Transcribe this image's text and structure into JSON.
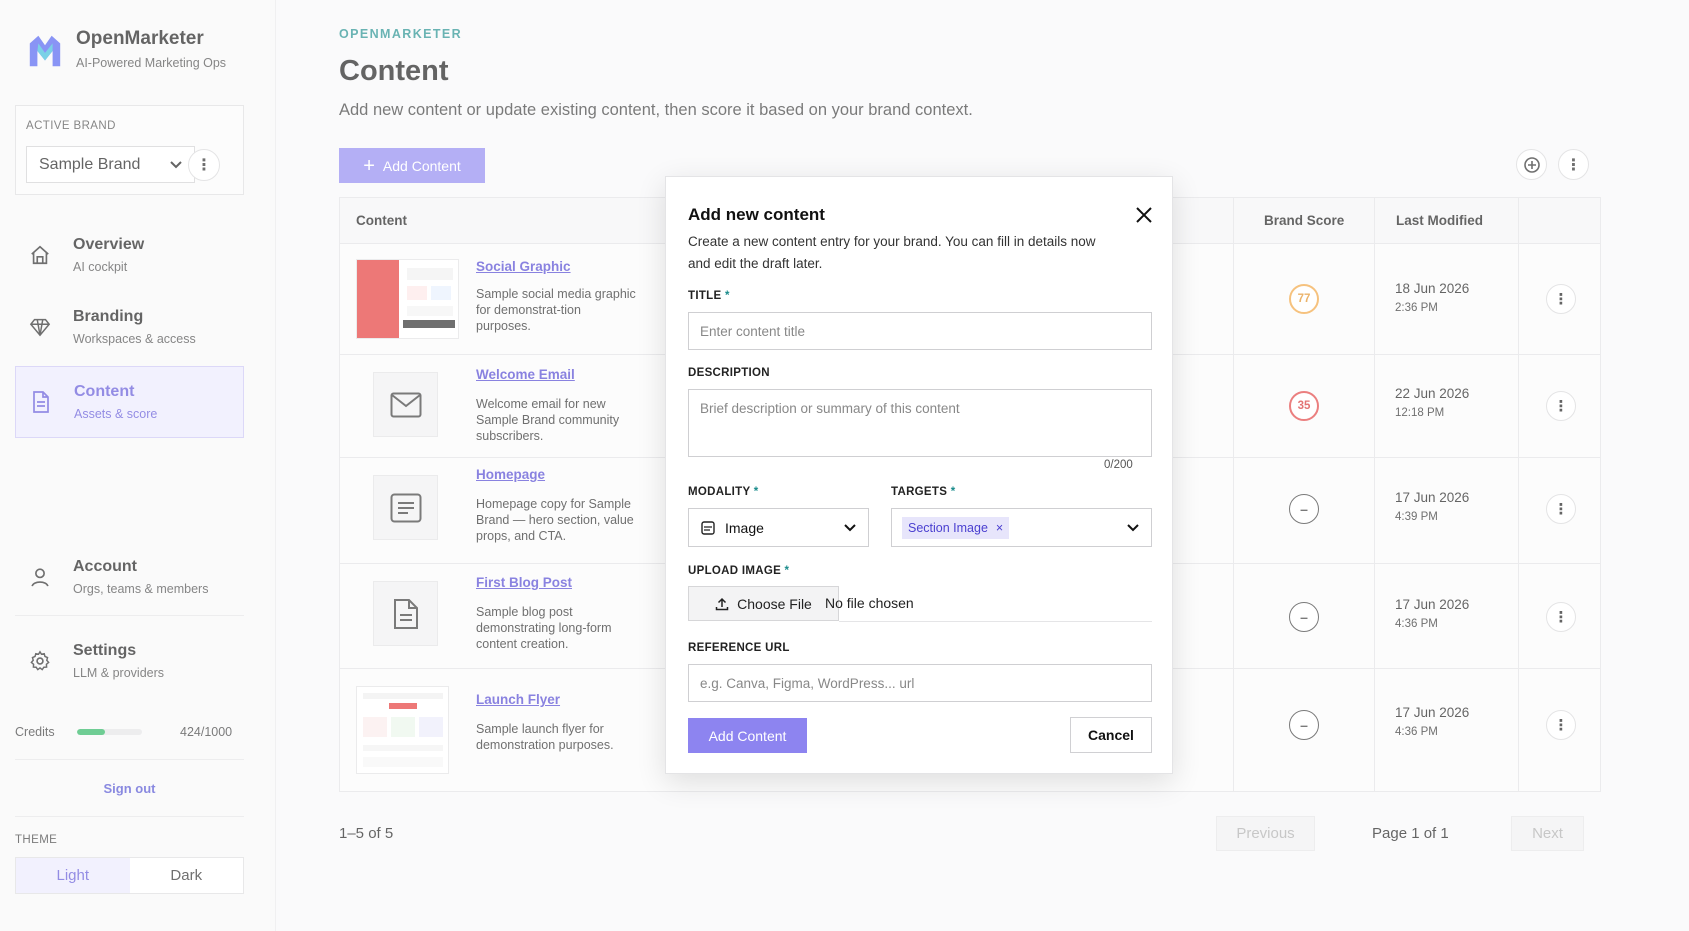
{
  "app": {
    "name": "OpenMarketer",
    "tagline": "AI-Powered Marketing Ops"
  },
  "active_brand": {
    "label": "ACTIVE BRAND",
    "selected": "Sample Brand"
  },
  "nav": [
    {
      "title": "Overview",
      "sub": "AI cockpit",
      "icon": "home-icon"
    },
    {
      "title": "Branding",
      "sub": "Workspaces & access",
      "icon": "diamond-icon"
    },
    {
      "title": "Content",
      "sub": "Assets & score",
      "icon": "document-icon",
      "active": true
    },
    {
      "title": "Account",
      "sub": "Orgs, teams & members",
      "icon": "user-icon"
    },
    {
      "title": "Settings",
      "sub": "LLM & providers",
      "icon": "gear-icon"
    }
  ],
  "credits": {
    "label": "Credits",
    "value": "424/1000",
    "fraction": 0.424
  },
  "sign_out": "Sign out",
  "theme": {
    "label": "THEME",
    "light": "Light",
    "dark": "Dark",
    "selected": "Light"
  },
  "page": {
    "eyebrow": "OPENMARKETER",
    "title": "Content",
    "subtitle": "Add new content or update existing content, then score it based on your brand context.",
    "add_button": "Add Content"
  },
  "table": {
    "headers": {
      "content": "Content",
      "brand_score": "Brand Score",
      "last_modified": "Last Modified"
    },
    "rows": [
      {
        "title": "Social Graphic",
        "desc": "Sample social media graphic for demonstrat-tion purposes.",
        "score": "77",
        "score_color": "#f2a23a",
        "date": "18 Jun 2026",
        "time": "2:36 PM",
        "thumb": "social-graphic-thumbnail"
      },
      {
        "title": "Welcome Email",
        "desc": "Welcome email for new Sample Brand community subscribers.",
        "score": "35",
        "score_color": "#e03b3b",
        "date": "22 Jun 2026",
        "time": "12:18 PM",
        "thumb": "mail-icon"
      },
      {
        "title": "Homepage",
        "desc": "Homepage copy for Sample Brand — hero section, value props, and CTA.",
        "score": "–",
        "date": "17 Jun 2026",
        "time": "4:39 PM",
        "thumb": "text-block-icon"
      },
      {
        "title": "First Blog Post",
        "desc": "Sample blog post demonstrating long-form content creation.",
        "score": "–",
        "date": "17 Jun 2026",
        "time": "4:36 PM",
        "thumb": "file-text-icon"
      },
      {
        "title": "Launch Flyer",
        "desc": "Sample launch flyer for demonstration purposes.",
        "score": "–",
        "date": "17 Jun 2026",
        "time": "4:36 PM",
        "thumb": "launch-flyer-thumbnail"
      }
    ]
  },
  "pagination": {
    "range": "1–5 of 5",
    "previous": "Previous",
    "page": "Page 1 of 1",
    "next": "Next"
  },
  "modal": {
    "title": "Add new content",
    "description": "Create a new content entry for your brand. You can fill in details now and edit the draft later.",
    "title_label": "TITLE",
    "title_placeholder": "Enter content title",
    "description_label": "DESCRIPTION",
    "description_placeholder": "Brief description or summary of this content",
    "counter": "0/200",
    "modality_label": "MODALITY",
    "modality_value": "Image",
    "targets_label": "TARGETS",
    "targets_chip": "Section Image",
    "upload_label": "UPLOAD IMAGE",
    "choose_file": "Choose File",
    "no_file": "No file chosen",
    "reference_label": "REFERENCE URL",
    "reference_placeholder": "e.g. Canva, Figma, WordPress... url",
    "submit": "Add Content",
    "cancel": "Cancel",
    "required_mark": "*"
  },
  "colors": {
    "accent": "#8d84f0",
    "accent_text": "#4a3fd0",
    "teal": "#1a8b8b",
    "credits_green": "#22b35b"
  }
}
